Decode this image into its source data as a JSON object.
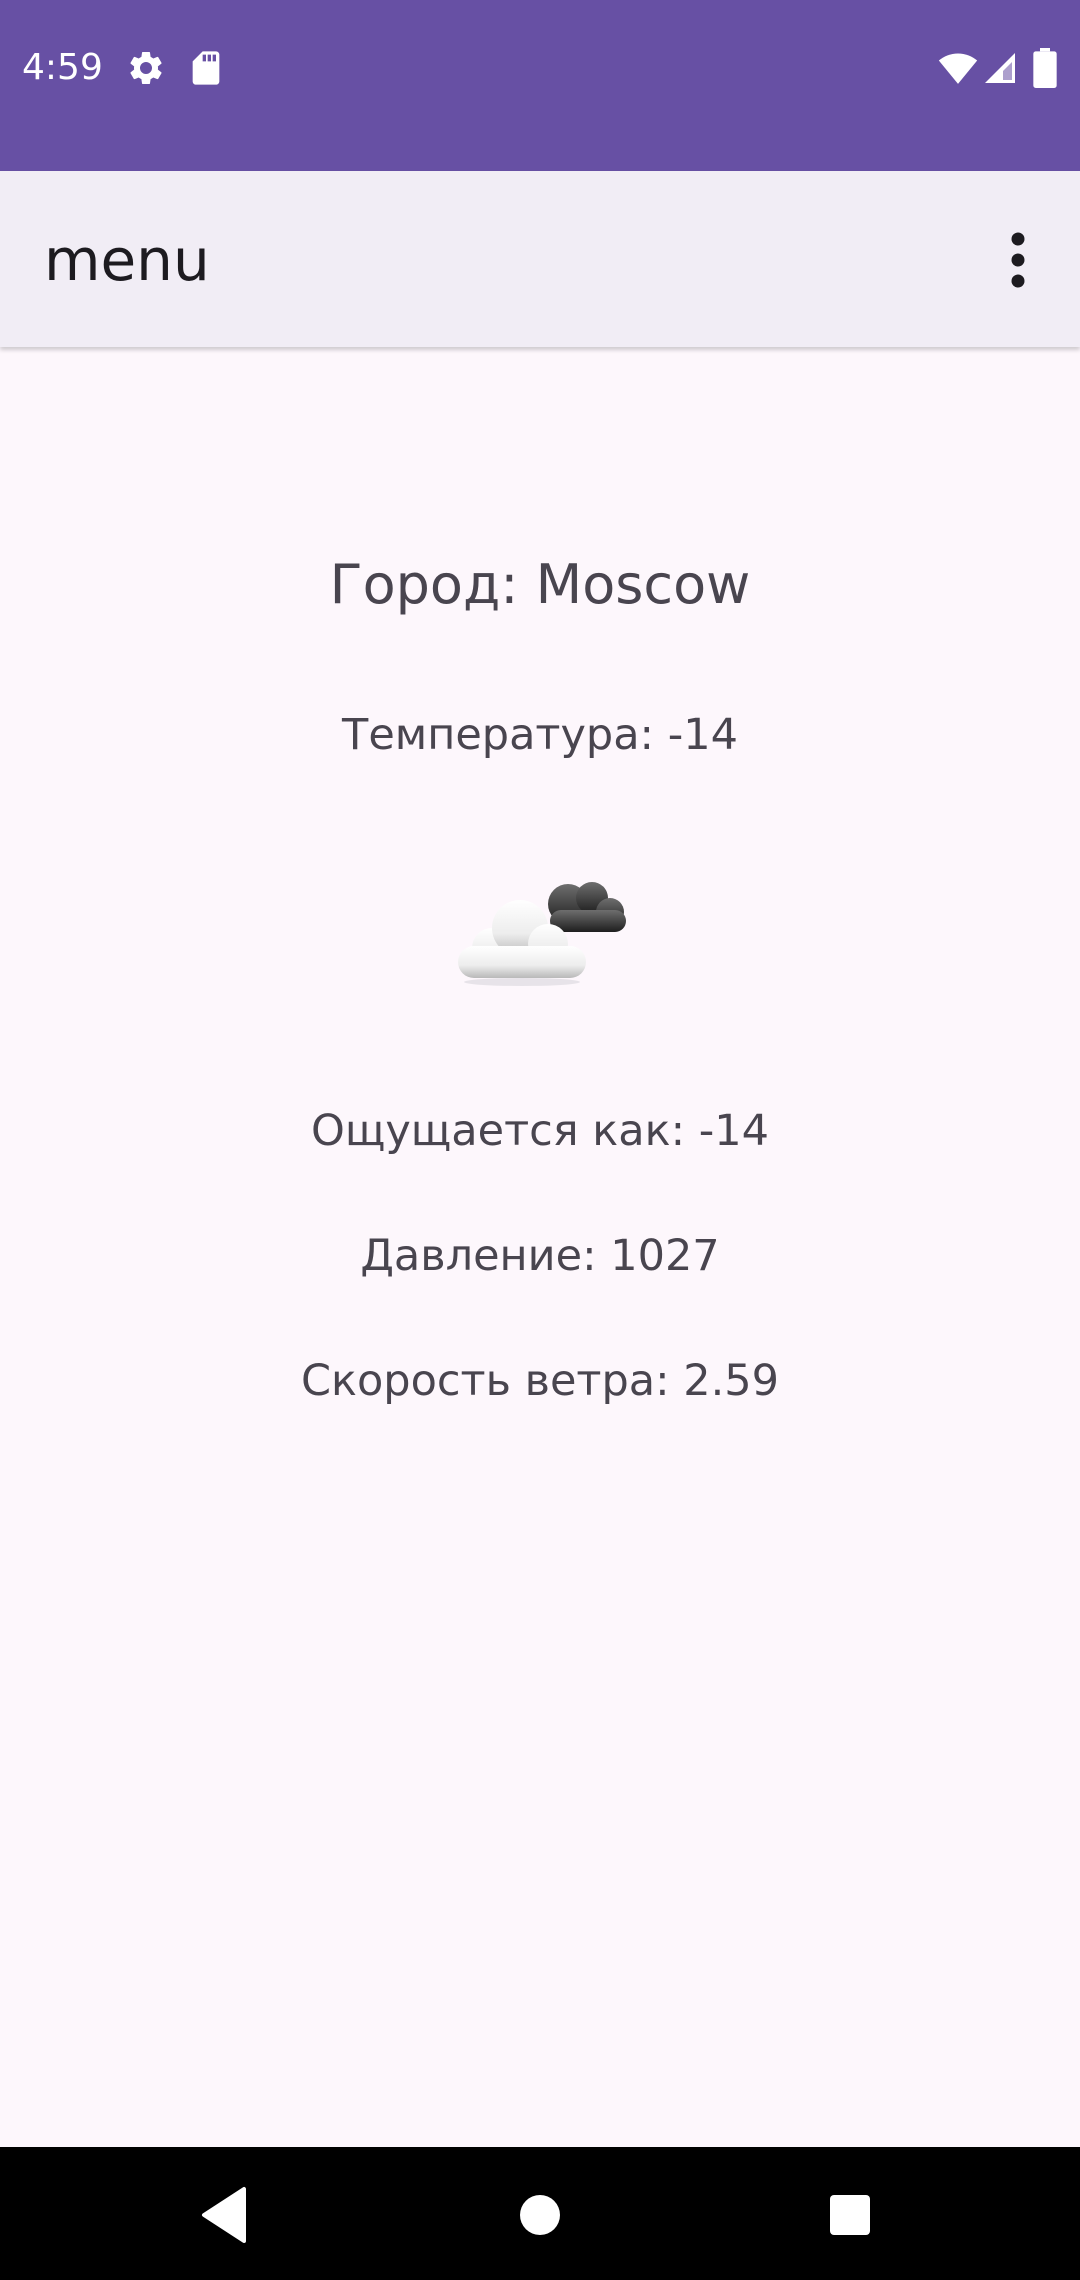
{
  "status_bar": {
    "time": "4:59",
    "icons_left": [
      "settings-gear-icon",
      "sd-card-icon"
    ],
    "icons_right": [
      "wifi-icon",
      "cellular-signal-icon",
      "battery-icon"
    ],
    "background_color": "#6750a4"
  },
  "app_bar": {
    "title": "menu",
    "overflow_icon": "more-vert-icon",
    "background_color": "#f1edf5"
  },
  "weather": {
    "city": "Город: Moscow",
    "temperature": "Температура: -14",
    "icon": "partly-cloudy-icon",
    "feels_like": "Ощущается как: -14",
    "pressure": "Давление: 1027",
    "wind_speed": "Скорость ветра: 2.59"
  },
  "nav_bar": {
    "buttons": [
      "back-icon",
      "home-icon",
      "recents-icon"
    ]
  }
}
